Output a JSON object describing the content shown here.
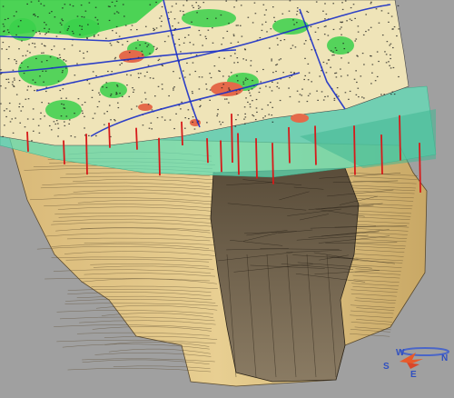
{
  "viewport": {
    "background": "#a0a0a0"
  },
  "layers": {
    "map": {
      "name": "map-surface",
      "base_color": "#efe4b8",
      "forest_color": "#3ad04a",
      "red_patch_color": "#e46a4a",
      "road_color": "#1a2fc8"
    },
    "transparent_surface": {
      "name": "transparent-horizon-surface",
      "color": "#5ee0b8",
      "opacity": 0.75
    },
    "boreholes": {
      "name": "borehole-lines",
      "color": "#d61a1a"
    },
    "geology": {
      "name": "geological-body",
      "light_color": "#dcbd7a",
      "dark_color": "#6b5c45"
    }
  },
  "compass": {
    "labels": {
      "west": "W",
      "north": "N",
      "south": "S",
      "east": "E"
    },
    "colors": {
      "arrow": "#e85a2a",
      "ring": "#4a66c8",
      "text": "#3050c0"
    }
  }
}
